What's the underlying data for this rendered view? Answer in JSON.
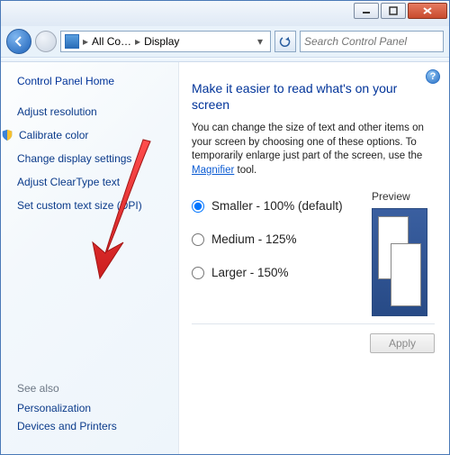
{
  "titlebar": {
    "minimize": "minimize",
    "maximize": "maximize",
    "close": "close"
  },
  "breadcrumb": {
    "item1": "All Co…",
    "item2": "Display"
  },
  "search": {
    "placeholder": "Search Control Panel"
  },
  "sidebar": {
    "home": "Control Panel Home",
    "links": {
      "adjust_resolution": "Adjust resolution",
      "calibrate_color": "Calibrate color",
      "change_display_settings": "Change display settings",
      "adjust_cleartype": "Adjust ClearType text",
      "set_custom_dpi": "Set custom text size (DPI)"
    },
    "see_also_hdr": "See also",
    "see_also": {
      "personalization": "Personalization",
      "devices_printers": "Devices and Printers"
    }
  },
  "main": {
    "title": "Make it easier to read what's on your screen",
    "desc_pre": "You can change the size of text and other items on your screen by choosing one of these options. To temporarily enlarge just part of the screen, use the ",
    "desc_link": "Magnifier",
    "desc_post": " tool.",
    "options": {
      "smaller": "Smaller - 100% (default)",
      "medium": "Medium - 125%",
      "larger": "Larger - 150%"
    },
    "preview_label": "Preview",
    "apply": "Apply"
  }
}
